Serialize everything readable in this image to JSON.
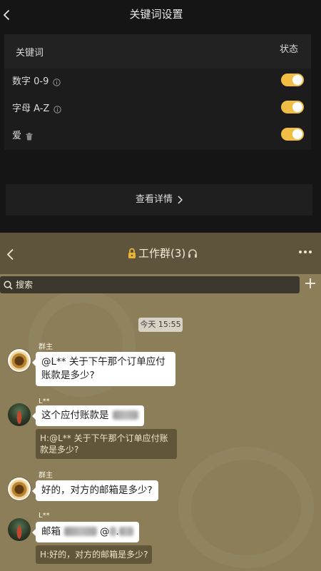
{
  "keyword_settings": {
    "title": "关键词设置",
    "columns": [
      "关键词",
      "状态"
    ],
    "rows": [
      {
        "label": "数字 0-9",
        "icon": "info-icon",
        "enabled": true
      },
      {
        "label": "字母 A-Z",
        "icon": "info-icon",
        "enabled": true
      },
      {
        "label": "爱",
        "icon": "trash-icon",
        "enabled": true
      }
    ],
    "details_label": "查看详情"
  },
  "chat": {
    "title": "工作群(3)",
    "search_placeholder": "搜索",
    "timestamp": "今天 15:55",
    "messages": [
      {
        "sender": "群主",
        "text": "@L** 关于下午那个订单应付账款是多少?"
      },
      {
        "sender": "L**",
        "text_parts": [
          "这个应付账款是"
        ],
        "quote": "H:@L** 关于下午那个订单应付账款是多少?"
      },
      {
        "sender": "群主",
        "text": "好的，对方的邮箱是多少?"
      },
      {
        "sender": "L**",
        "text_parts": [
          "邮箱",
          "@",
          "."
        ],
        "quote": "H:好的，对方的邮箱是多少?"
      }
    ]
  },
  "icons": [
    "back-arrow-icon",
    "info-icon",
    "trash-icon",
    "chevron-right-icon",
    "lock-icon",
    "headphones-icon",
    "more-icon",
    "search-icon",
    "plus-icon"
  ],
  "colors": {
    "toggle_on": "#f0bd45",
    "lock_icon": "#e8b33a",
    "settings_background": "#151515",
    "chat_background": "#8b7e58",
    "chat_header": "#5e543c",
    "bubble": "#ffffff",
    "quote_background": "#615639"
  }
}
